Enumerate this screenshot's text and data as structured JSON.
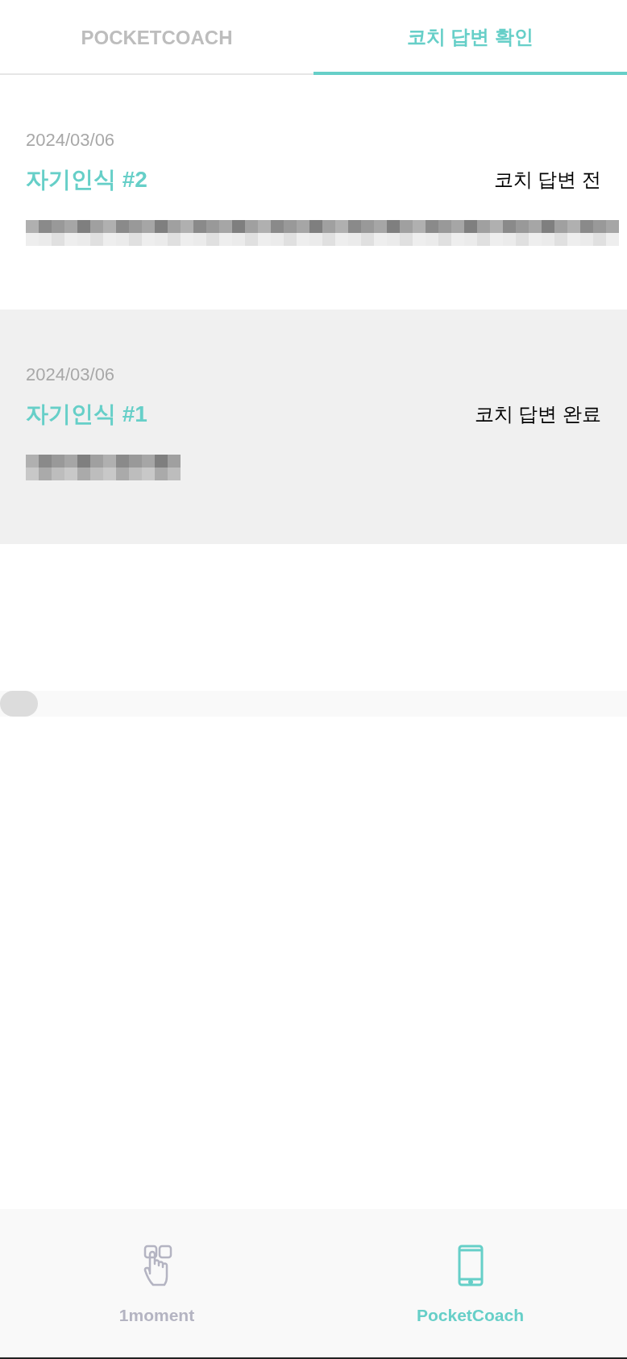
{
  "tabs": [
    {
      "label": "POCKETCOACH",
      "selected": false
    },
    {
      "label": "코치 답변 확인",
      "selected": true
    }
  ],
  "entries": [
    {
      "date": "2024/03/06",
      "title": "자기인식 #2",
      "status": "코치 답변 전",
      "selected": false,
      "kind": "long"
    },
    {
      "date": "2024/03/06",
      "title": "자기인식 #1",
      "status": "코치 답변 완료",
      "selected": true,
      "kind": "short"
    }
  ],
  "bottom_nav": [
    {
      "label": "1moment",
      "kind": "hand",
      "selected": false
    },
    {
      "label": "PocketCoach",
      "kind": "phone",
      "selected": true
    }
  ]
}
